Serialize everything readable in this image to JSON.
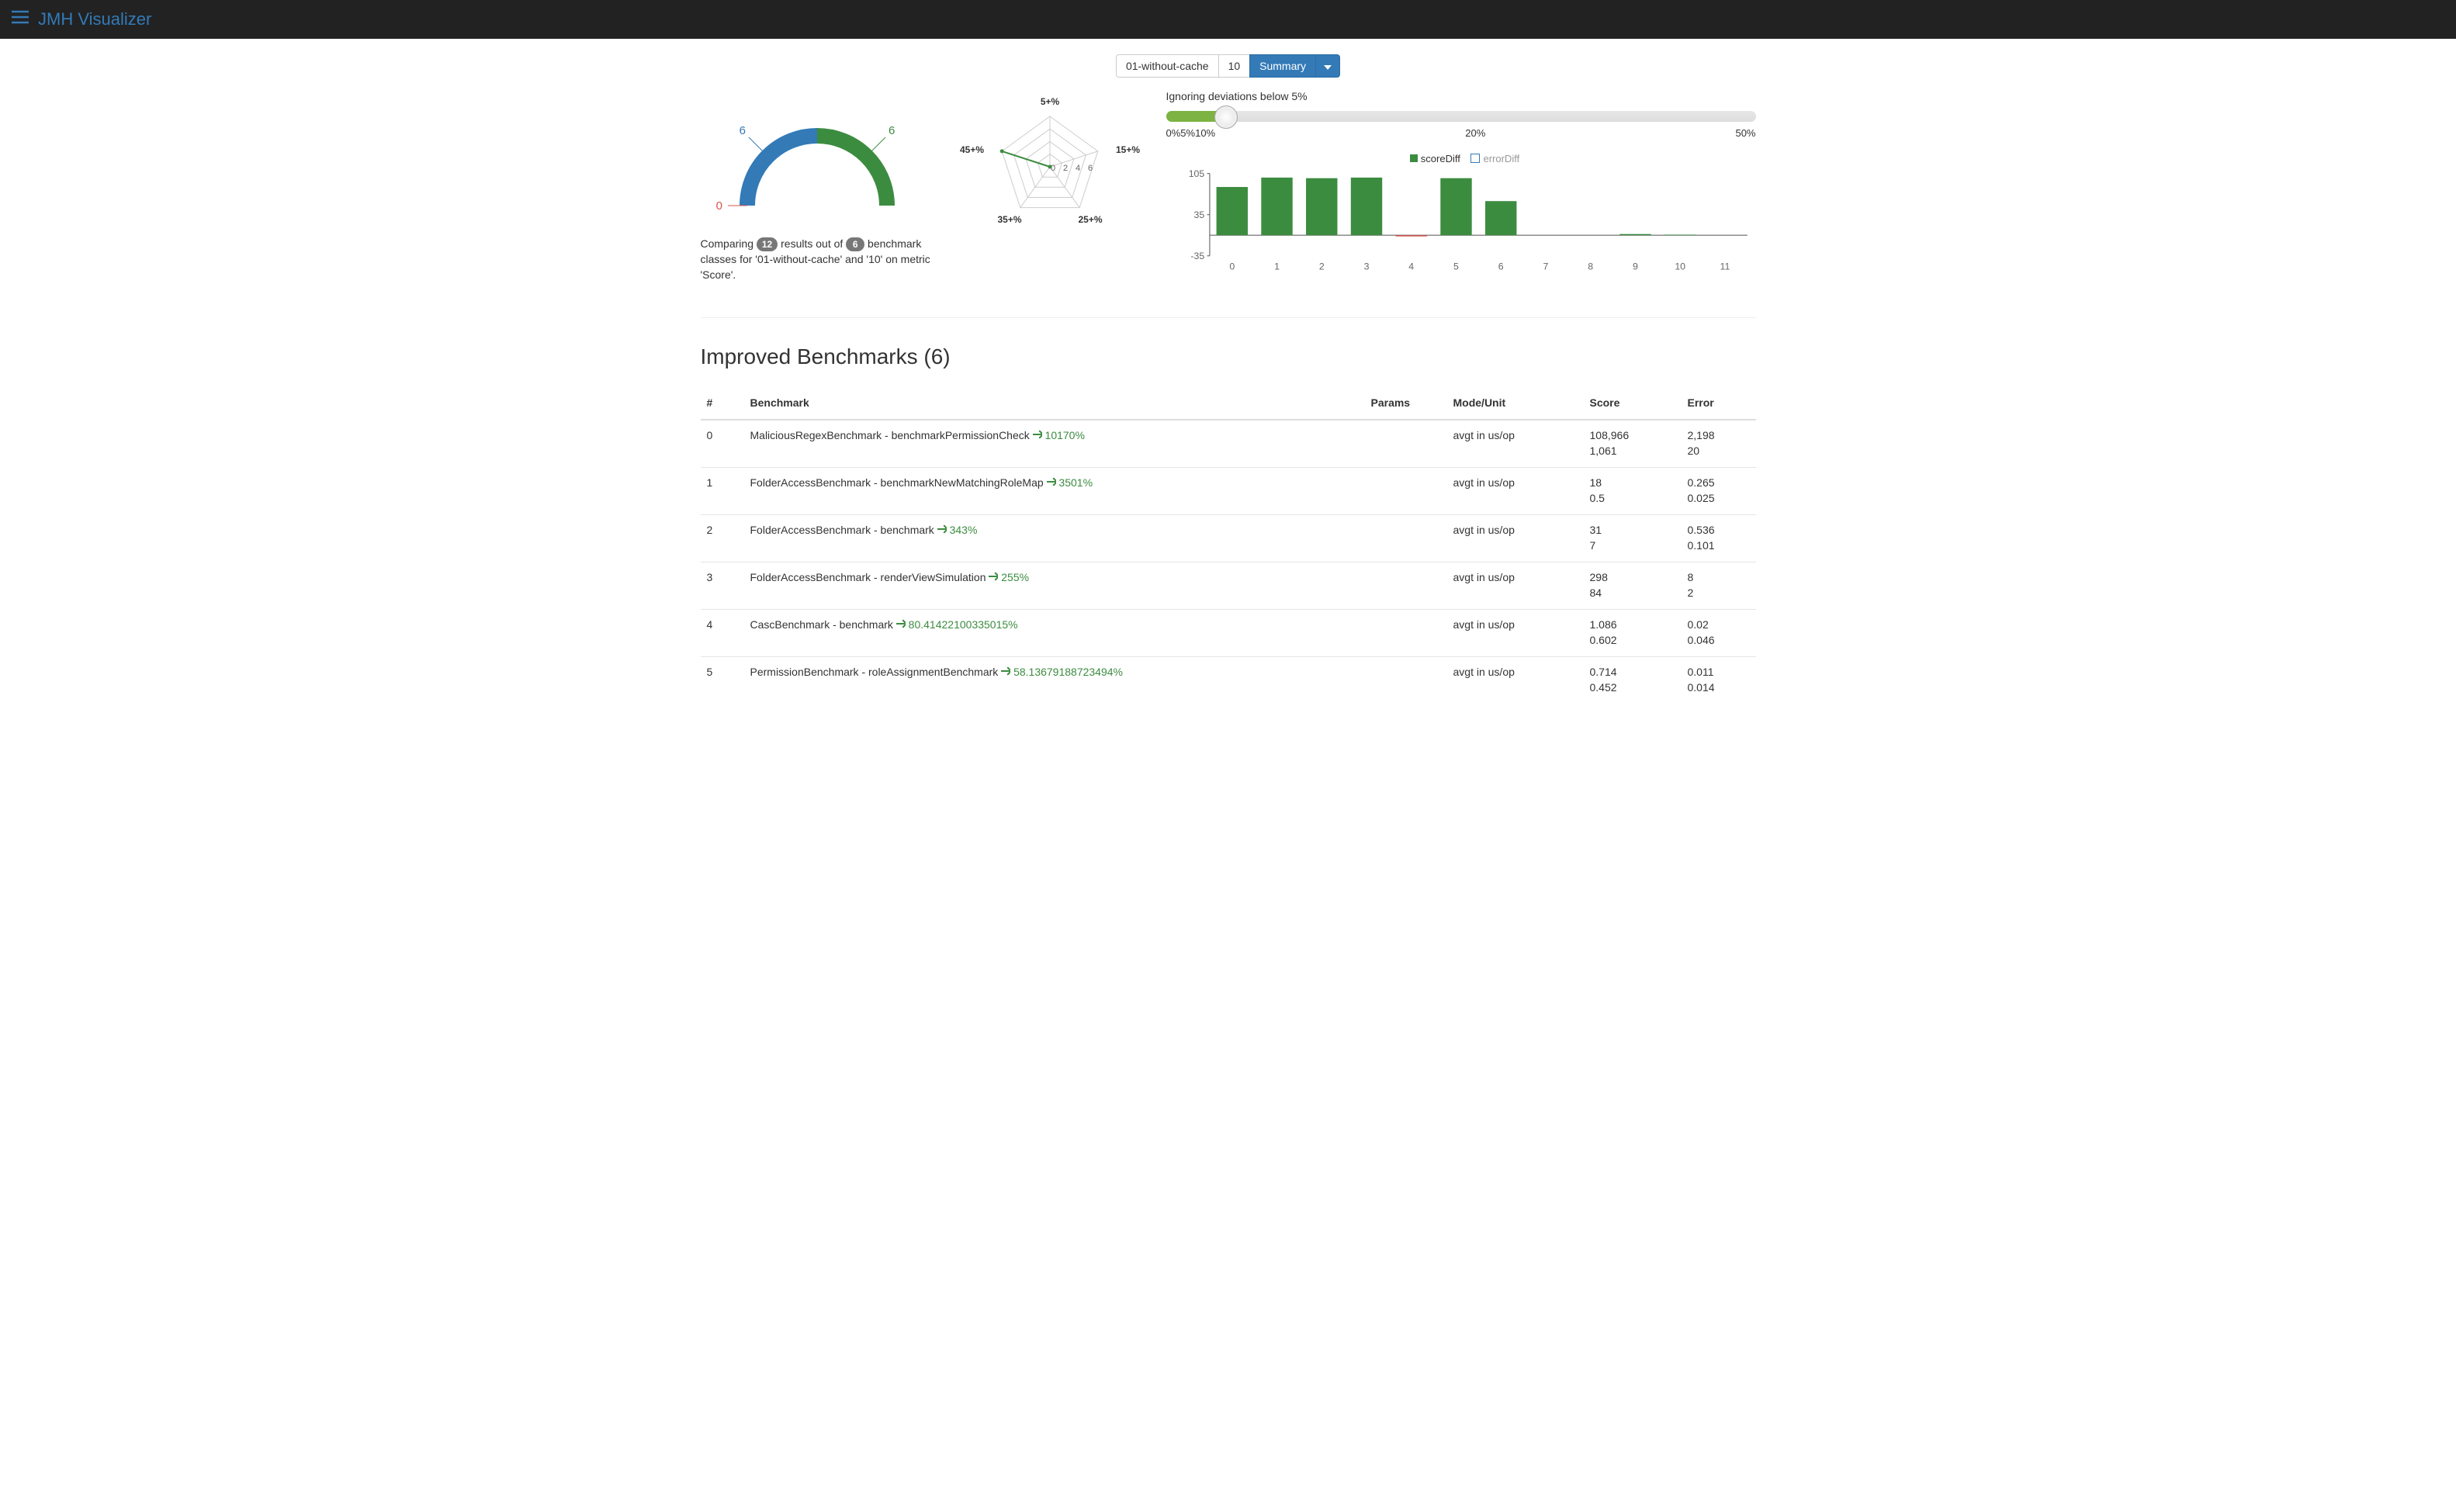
{
  "header": {
    "title": "JMH Visualizer"
  },
  "buttons": {
    "a": "01-without-cache",
    "b": "10",
    "summary": "Summary"
  },
  "gauge": {
    "left": "6",
    "right": "6",
    "zero": "0"
  },
  "radar": {
    "labels": [
      "5+%",
      "15+%",
      "25+%",
      "35+%",
      "45+%"
    ],
    "scale": [
      "0",
      "2",
      "4",
      "6"
    ]
  },
  "compare": {
    "pre": "Comparing ",
    "count": "12",
    "mid": " results out of ",
    "classes": "6",
    "post": " benchmark classes for '01-without-cache' and '10' on metric 'Score'."
  },
  "slider": {
    "label": "Ignoring deviations below 5%",
    "ticks": [
      "0%",
      "5%",
      "10%",
      "20%",
      "50%"
    ]
  },
  "bar_legend": {
    "a": "scoreDiff",
    "b": "errorDiff"
  },
  "chart_data": {
    "type": "bar",
    "x": [
      "0",
      "1",
      "2",
      "3",
      "4",
      "5",
      "6",
      "7",
      "8",
      "9",
      "10",
      "11"
    ],
    "series": [
      {
        "name": "scoreDiff",
        "values": [
          82,
          98,
          97,
          98,
          0,
          97,
          58,
          0,
          0,
          2,
          1,
          0
        ]
      },
      {
        "name": "errorDiff",
        "values": [
          0,
          0,
          0,
          0,
          -2,
          0,
          0,
          0,
          0,
          0,
          0,
          0
        ]
      }
    ],
    "ylim": [
      -35,
      105
    ],
    "yticks": [
      -35,
      35,
      105
    ]
  },
  "section_title": "Improved Benchmarks (6)",
  "cols": {
    "idx": "#",
    "bench": "Benchmark",
    "params": "Params",
    "mode": "Mode/Unit",
    "score": "Score",
    "err": "Error"
  },
  "rows": [
    {
      "i": "0",
      "n": "MaliciousRegexBenchmark - benchmarkPermissionCheck",
      "p": "10170%",
      "params": "",
      "m": "avgt in us/op",
      "s": "108,966\n1,061",
      "e": "2,198\n20"
    },
    {
      "i": "1",
      "n": "FolderAccessBenchmark - benchmarkNewMatchingRoleMap",
      "p": "3501%",
      "params": "",
      "m": "avgt in us/op",
      "s": "18\n0.5",
      "e": "0.265\n0.025"
    },
    {
      "i": "2",
      "n": "FolderAccessBenchmark - benchmark",
      "p": "343%",
      "params": "",
      "m": "avgt in us/op",
      "s": "31\n7",
      "e": "0.536\n0.101"
    },
    {
      "i": "3",
      "n": "FolderAccessBenchmark - renderViewSimulation",
      "p": "255%",
      "params": "",
      "m": "avgt in us/op",
      "s": "298\n84",
      "e": "8\n2"
    },
    {
      "i": "4",
      "n": "CascBenchmark - benchmark",
      "p": "80.41422100335015%",
      "params": "",
      "m": "avgt in us/op",
      "s": "1.086\n0.602",
      "e": "0.02\n0.046"
    },
    {
      "i": "5",
      "n": "PermissionBenchmark - roleAssignmentBenchmark",
      "p": "58.13679188723494%",
      "params": "",
      "m": "avgt in us/op",
      "s": "0.714\n0.452",
      "e": "0.011\n0.014"
    }
  ]
}
